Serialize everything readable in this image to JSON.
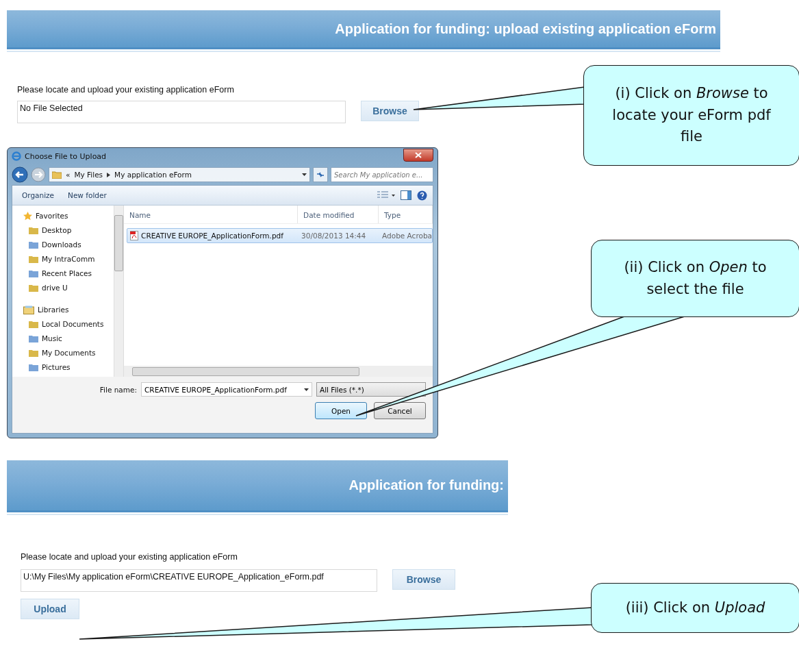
{
  "section_1": {
    "header_title": "Application for funding: upload existing application eForm",
    "prompt": "Please locate and upload your existing application eForm",
    "file_field": {
      "value": "No File Selected"
    },
    "browse_button": "Browse"
  },
  "dialog": {
    "title": "Choose File to Upload",
    "breadcrumb": [
      "«",
      "My Files",
      "My application eForm"
    ],
    "search": {
      "placeholder": "Search My application e..."
    },
    "toolbar": [
      "Organize",
      "New folder"
    ],
    "nav": [
      {
        "label": "Favorites",
        "children": [
          {
            "label": "Desktop"
          },
          {
            "label": "Downloads"
          },
          {
            "label": "My IntraComm"
          },
          {
            "label": "Recent Places"
          },
          {
            "label": "drive U"
          }
        ]
      },
      {
        "label": "Libraries",
        "children": [
          {
            "label": "Local Documents"
          },
          {
            "label": "Music"
          },
          {
            "label": "My Documents"
          },
          {
            "label": "Pictures"
          }
        ]
      }
    ],
    "columns": [
      "Name",
      "Date modified",
      "Type"
    ],
    "rows": [
      {
        "name": "CREATIVE EUROPE_ApplicationForm.pdf",
        "date": "30/08/2013 14:44",
        "type": "Adobe Acroba",
        "selected": true
      }
    ],
    "file_name_label": "File name:",
    "file_name": "CREATIVE EUROPE_ApplicationForm.pdf",
    "filter": "All Files (*.*)",
    "buttons": [
      "Open",
      "Cancel"
    ]
  },
  "section_2": {
    "header_title": "Application for funding:",
    "prompt": "Please locate and upload your existing application eForm",
    "file_field": {
      "value": "U:\\My Files\\My application eForm\\CREATIVE EUROPE_Application_eForm.pdf"
    },
    "browse_button": "Browse",
    "upload_button": "Upload"
  },
  "callouts": [
    {
      "text": "(i) Click on *Browse* to locate your eForm pdf file"
    },
    {
      "text": "(ii) Click on *Open* to select the file"
    },
    {
      "text": "(iii) Click on *Upload*"
    }
  ]
}
